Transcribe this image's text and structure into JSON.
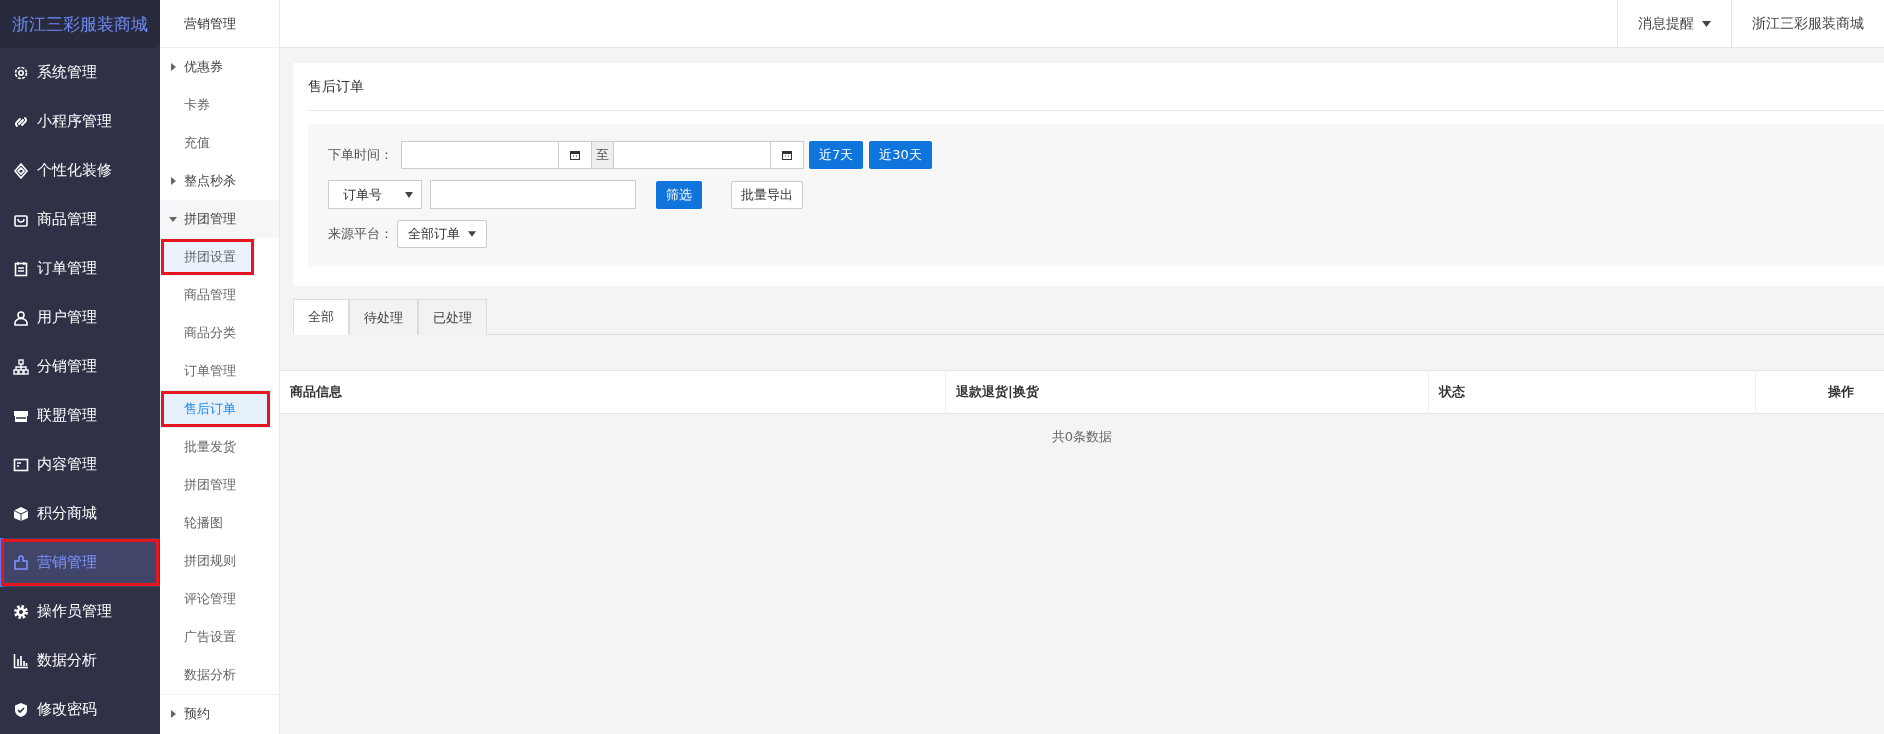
{
  "brand": "浙江三彩服装商城",
  "sidebar": {
    "items": [
      {
        "label": "系统管理",
        "selected": false,
        "annotated": false
      },
      {
        "label": "小程序管理",
        "selected": false,
        "annotated": false
      },
      {
        "label": "个性化装修",
        "selected": false,
        "annotated": false
      },
      {
        "label": "商品管理",
        "selected": false,
        "annotated": false
      },
      {
        "label": "订单管理",
        "selected": false,
        "annotated": false
      },
      {
        "label": "用户管理",
        "selected": false,
        "annotated": false
      },
      {
        "label": "分销管理",
        "selected": false,
        "annotated": false
      },
      {
        "label": "联盟管理",
        "selected": false,
        "annotated": false
      },
      {
        "label": "内容管理",
        "selected": false,
        "annotated": false
      },
      {
        "label": "积分商城",
        "selected": false,
        "annotated": false
      },
      {
        "label": "营销管理",
        "selected": true,
        "annotated": true
      },
      {
        "label": "操作员管理",
        "selected": false,
        "annotated": false
      },
      {
        "label": "数据分析",
        "selected": false,
        "annotated": false
      },
      {
        "label": "修改密码",
        "selected": false,
        "annotated": false
      }
    ]
  },
  "submenu": {
    "title": "营销管理",
    "items": [
      {
        "kind": "group",
        "label": "优惠券",
        "expanded": false
      },
      {
        "kind": "link",
        "label": "卡券",
        "selected": false,
        "hovered": false,
        "annotated": false
      },
      {
        "kind": "link",
        "label": "充值",
        "selected": false,
        "hovered": false,
        "annotated": false
      },
      {
        "kind": "group",
        "label": "整点秒杀",
        "expanded": false
      },
      {
        "kind": "group",
        "label": "拼团管理",
        "expanded": true,
        "children": [
          {
            "label": "拼团设置",
            "selected": false,
            "hovered": true,
            "annotated": true
          },
          {
            "label": "商品管理",
            "selected": false,
            "hovered": false,
            "annotated": false
          },
          {
            "label": "商品分类",
            "selected": false,
            "hovered": false,
            "annotated": false
          },
          {
            "label": "订单管理",
            "selected": false,
            "hovered": false,
            "annotated": false
          },
          {
            "label": "售后订单",
            "selected": true,
            "hovered": false,
            "annotated": true
          },
          {
            "label": "批量发货",
            "selected": false,
            "hovered": false,
            "annotated": false
          },
          {
            "label": "拼团管理",
            "selected": false,
            "hovered": false,
            "annotated": false
          },
          {
            "label": "轮播图",
            "selected": false,
            "hovered": false,
            "annotated": false
          },
          {
            "label": "拼团规则",
            "selected": false,
            "hovered": false,
            "annotated": false
          },
          {
            "label": "评论管理",
            "selected": false,
            "hovered": false,
            "annotated": false
          },
          {
            "label": "广告设置",
            "selected": false,
            "hovered": false,
            "annotated": false
          },
          {
            "label": "数据分析",
            "selected": false,
            "hovered": false,
            "annotated": false
          }
        ]
      },
      {
        "kind": "group",
        "label": "预约",
        "expanded": false
      }
    ]
  },
  "topbar": {
    "notifications": "消息提醒",
    "store": "浙江三彩服装商城"
  },
  "page": {
    "title": "售后订单",
    "filters": {
      "date_label": "下单时间：",
      "range_separator": "至",
      "quick_buttons": [
        "近7天",
        "近30天"
      ],
      "search_type": "订单号",
      "search_button": "筛选",
      "export_button": "批量导出",
      "source_label": "来源平台：",
      "source_value": "全部订单"
    },
    "tabs": [
      {
        "label": "全部",
        "selected": true
      },
      {
        "label": "待处理",
        "selected": false
      },
      {
        "label": "已处理",
        "selected": false
      }
    ],
    "table": {
      "columns": [
        "商品信息",
        "退款退货|换货",
        "状态",
        "操作"
      ],
      "empty_text": "共0条数据"
    }
  }
}
